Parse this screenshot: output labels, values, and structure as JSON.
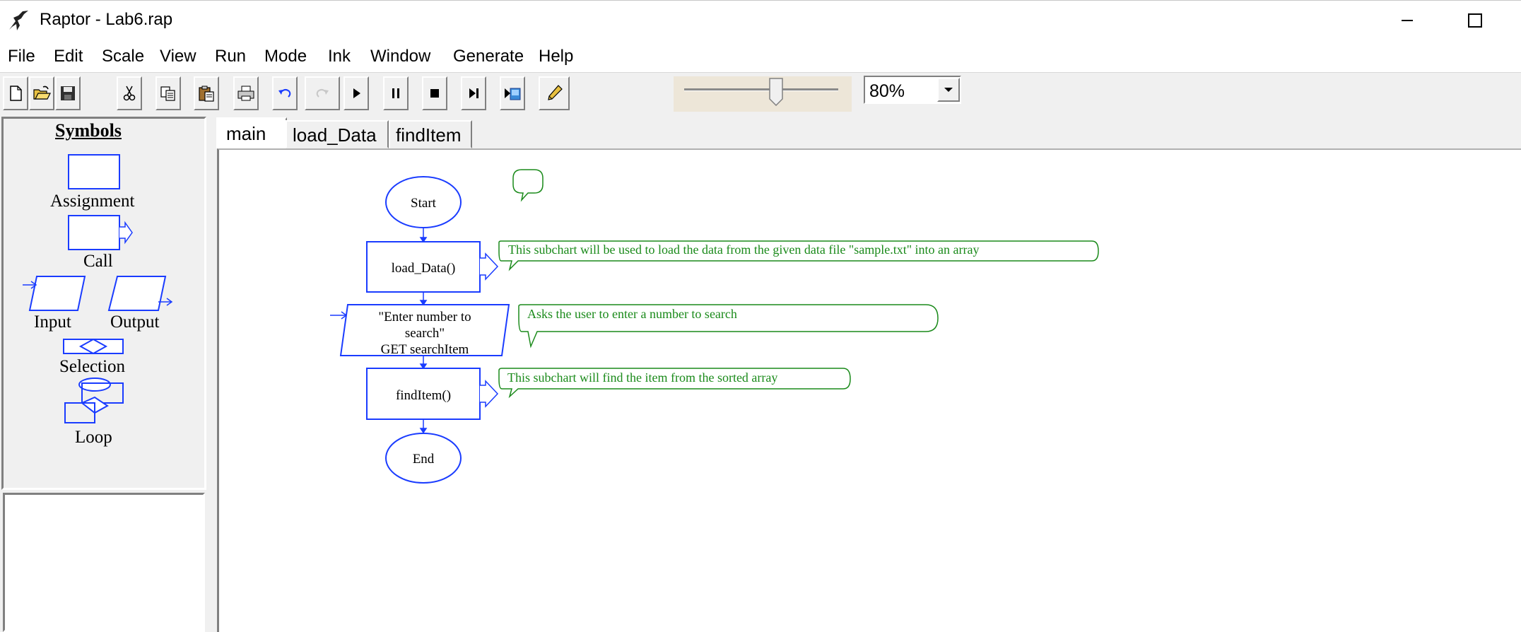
{
  "window": {
    "title": "Raptor - Lab6.rap",
    "app_icon": "raptor-icon",
    "controls": [
      "minimize-icon",
      "maximize-icon"
    ]
  },
  "menu": [
    "File",
    "Edit",
    "Scale",
    "View",
    "Run",
    "Mode",
    "Ink",
    "Window",
    "Generate",
    "Help"
  ],
  "toolbar": {
    "buttons": [
      "new-icon",
      "open-icon",
      "save-icon",
      "cut-icon",
      "copy-icon",
      "paste-icon",
      "print-icon",
      "undo-icon",
      "redo-icon",
      "play-icon",
      "pause-icon",
      "stop-icon",
      "step-icon",
      "run-to-completion-icon",
      "pen-icon"
    ],
    "zoom": "80%"
  },
  "symbols": {
    "title": "Symbols",
    "items": [
      "Assignment",
      "Call",
      "Input",
      "Output",
      "Selection",
      "Loop"
    ]
  },
  "tabs": [
    "main",
    "load_Data",
    "findItem"
  ],
  "active_tab": "main",
  "flowchart": {
    "start": "Start",
    "call1": "load_Data()",
    "input_line1": "\"Enter number to",
    "input_line2": "search\"",
    "input_line3": "GET searchItem",
    "call2": "findItem()",
    "end": "End",
    "comments": {
      "call1": "This subchart will be used to load the data from the given data file \"sample.txt\" into an array",
      "input": "Asks the user to enter a number to search",
      "call2": "This subchart will find the item from the sorted array"
    }
  },
  "colors": {
    "flow_blue": "#1a3cff",
    "comment_green": "#1a8a1a"
  }
}
